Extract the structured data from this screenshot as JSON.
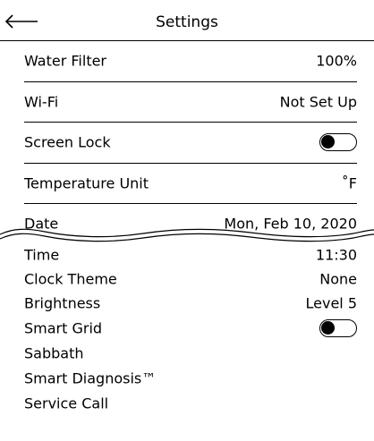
{
  "header": {
    "title": "Settings",
    "back_icon": "arrow-left-icon"
  },
  "settings_top": [
    {
      "label": "Water Filter",
      "value": "100%"
    },
    {
      "label": "Wi-Fi",
      "value": "Not Set Up"
    },
    {
      "label": "Screen Lock",
      "toggle": "off"
    },
    {
      "label": "Temperature Unit",
      "value": "˚F"
    },
    {
      "label": "Date",
      "value": "Mon, Feb 10, 2020"
    }
  ],
  "settings_bottom": [
    {
      "label": "Time",
      "value": "11:30"
    },
    {
      "label": "Clock Theme",
      "value": "None"
    },
    {
      "label": "Brightness",
      "value": "Level 5"
    },
    {
      "label": "Smart Grid",
      "toggle": "off"
    },
    {
      "label": "Sabbath",
      "value": ""
    },
    {
      "label": "Smart Diagnosis™",
      "value": ""
    },
    {
      "label": "Service Call",
      "value": ""
    }
  ]
}
